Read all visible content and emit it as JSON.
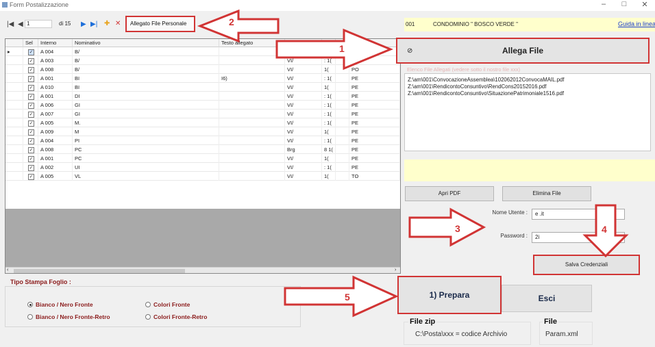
{
  "window": {
    "title": "Form Postalizzazione",
    "min": "–",
    "max": "□",
    "close": "✕"
  },
  "nav": {
    "first": "|◀",
    "prev": "◀",
    "record": "1",
    "total": "di 15",
    "next": "▶",
    "last": "▶|",
    "add": "✚",
    "delete": "✕",
    "allegato_label": "Allegato File Personale"
  },
  "grid": {
    "columns": [
      "",
      "Sel",
      "Interno",
      "Nominativo",
      "Testo allegato",
      "In",
      "",
      "",
      ""
    ],
    "rows": [
      {
        "current": true,
        "interno": "A 004",
        "nom": "B/",
        "testo": "",
        "ind": "B.T",
        "n": "",
        "c": "",
        "p": ""
      },
      {
        "current": false,
        "interno": "A 003",
        "nom": "B/",
        "testo": "",
        "ind": "VI/",
        "n": ": 1(",
        "c": "",
        "p": "PE"
      },
      {
        "current": false,
        "interno": "A 008",
        "nom": "B/",
        "testo": "",
        "ind": "VI/",
        "n": "1(",
        "c": "",
        "p": "PO"
      },
      {
        "current": false,
        "interno": "A 001",
        "nom": "BI",
        "testo": "I6)",
        "ind": "VI/",
        "n": ": 1(",
        "c": "",
        "p": "PE"
      },
      {
        "current": false,
        "interno": "A 010",
        "nom": "BI",
        "testo": "",
        "ind": "VI/",
        "n": "1(",
        "c": "",
        "p": "PE"
      },
      {
        "current": false,
        "interno": "A 001",
        "nom": "DI",
        "testo": "",
        "ind": "VI/",
        "n": ": 1(",
        "c": "",
        "p": "PE"
      },
      {
        "current": false,
        "interno": "A 006",
        "nom": "GI",
        "testo": "",
        "ind": "VI/",
        "n": ": 1(",
        "c": "",
        "p": "PE"
      },
      {
        "current": false,
        "interno": "A 007",
        "nom": "GI",
        "testo": "",
        "ind": "VI/",
        "n": ": 1(",
        "c": "",
        "p": "PE"
      },
      {
        "current": false,
        "interno": "A 005",
        "nom": "M.",
        "testo": "",
        "ind": "VI/",
        "n": ": 1(",
        "c": "",
        "p": "PE"
      },
      {
        "current": false,
        "interno": "A 009",
        "nom": "M",
        "testo": "",
        "ind": "VI/",
        "n": "1(",
        "c": "",
        "p": "PE"
      },
      {
        "current": false,
        "interno": "A 004",
        "nom": "PI",
        "testo": "",
        "ind": "VI/",
        "n": ": 1(",
        "c": "",
        "p": "PE"
      },
      {
        "current": false,
        "interno": "A 008",
        "nom": "PC",
        "testo": "",
        "ind": "Brg",
        "n": "8 1(",
        "c": "",
        "p": "PE"
      },
      {
        "current": false,
        "interno": "A 001",
        "nom": "PC",
        "testo": "",
        "ind": "VI/",
        "n": "1(",
        "c": "",
        "p": "PE"
      },
      {
        "current": false,
        "interno": "A 002",
        "nom": "UI",
        "testo": "",
        "ind": "VI/",
        "n": ": 1(",
        "c": "",
        "p": "PE"
      },
      {
        "current": false,
        "interno": "A 005",
        "nom": "VL",
        "testo": "",
        "ind": "VI/",
        "n": "1(",
        "c": "",
        "p": "TO"
      }
    ]
  },
  "tipo": {
    "label": "Tipo Stampa Foglio :",
    "options": [
      "Bianco / Nero Fronte",
      "Colori Fronte",
      "Bianco / Nero Fronte-Retro",
      "Colori Fronte-Retro"
    ]
  },
  "right": {
    "code": "001",
    "condominio": "CONDOMINIO \" BOSCO VERDE \"",
    "guida": "Guida in linea",
    "allega_label": "Allega File",
    "files_label": "Elenco File Allegati (vedere sotto il nostro file xxx)",
    "files": [
      "Z:\\am\\001\\ConvocazioneAssemblea\\102062012ConvocaMAIL.pdf",
      "Z:\\am\\001\\RendicontoConsuntivo\\RendCons20152016.pdf",
      "Z:\\am\\001\\RendicontoConsuntivo\\SituazionePatrimoniale1516.pdf"
    ],
    "apri_pdf": "Apri PDF",
    "elimina_file": "Elimina File",
    "nome_utente_label": "Nome Utente :",
    "nome_utente_value": "e            .it",
    "password_label": "Password :",
    "password_value": "2i",
    "salva": "Salva Credenziali",
    "prepara": "1) Prepara",
    "esci": "Esci",
    "file_zip_label": "File zip",
    "file_zip_value": "C:\\Posta\\xxx = codice Archivio",
    "file_label": "File",
    "file_value": "Param.xml"
  },
  "annotations": [
    "1",
    "2",
    "3",
    "4",
    "5"
  ],
  "colors": {
    "accent_red": "#d13434",
    "highlight_yellow": "#ffffcc",
    "option_red": "#8b1c1c"
  }
}
